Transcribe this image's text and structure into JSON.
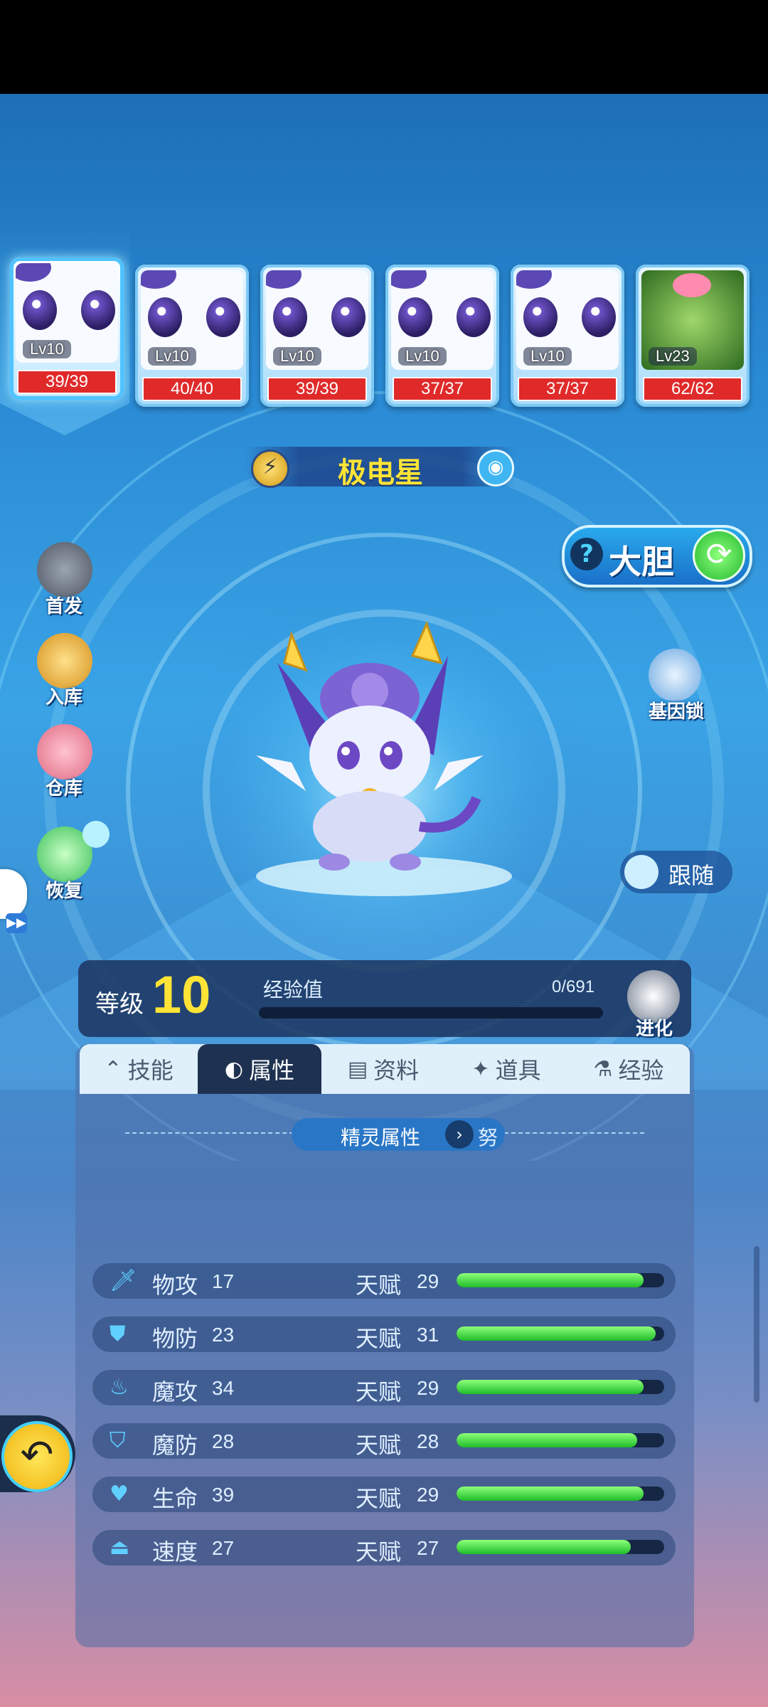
{
  "team": [
    {
      "level": "Lv10",
      "hp": "39/39",
      "selected": true
    },
    {
      "level": "Lv10",
      "hp": "40/40",
      "selected": false
    },
    {
      "level": "Lv10",
      "hp": "39/39",
      "selected": false
    },
    {
      "level": "Lv10",
      "hp": "37/37",
      "selected": false
    },
    {
      "level": "Lv10",
      "hp": "37/37",
      "selected": false
    },
    {
      "level": "Lv23",
      "hp": "62/62",
      "selected": false
    }
  ],
  "pet": {
    "name": "极电星",
    "nature": "大胆"
  },
  "side_left": [
    "首发",
    "入库",
    "仓库",
    "恢复"
  ],
  "side_right": {
    "gene_lock": "基因锁",
    "follow": "跟随"
  },
  "level": {
    "label": "等级",
    "value": "10",
    "exp_label": "经验值",
    "exp_value": "0/691",
    "exp_fraction": 0,
    "evolve": "进化"
  },
  "tabs": [
    {
      "label": "技能",
      "icon": "skill-icon",
      "active": false
    },
    {
      "label": "属性",
      "icon": "attribute-icon",
      "active": true
    },
    {
      "label": "资料",
      "icon": "clipboard-icon",
      "active": false
    },
    {
      "label": "道具",
      "icon": "item-icon",
      "active": false
    },
    {
      "label": "经验",
      "icon": "flask-icon",
      "active": false
    }
  ],
  "attr_header": {
    "title": "精灵属性",
    "extra": "努"
  },
  "talent_label": "天赋",
  "stats": [
    {
      "name": "物攻",
      "value": "17",
      "talent": "29",
      "fill": 0.9,
      "icon": "sword-icon"
    },
    {
      "name": "物防",
      "value": "23",
      "talent": "31",
      "fill": 0.96,
      "icon": "shield-icon"
    },
    {
      "name": "魔攻",
      "value": "34",
      "talent": "29",
      "fill": 0.9,
      "icon": "flame-icon"
    },
    {
      "name": "魔防",
      "value": "28",
      "talent": "28",
      "fill": 0.87,
      "icon": "magic-shield-icon"
    },
    {
      "name": "生命",
      "value": "39",
      "talent": "29",
      "fill": 0.9,
      "icon": "heart-icon"
    },
    {
      "name": "速度",
      "value": "27",
      "talent": "27",
      "fill": 0.84,
      "icon": "boot-icon"
    }
  ],
  "colors": {
    "accent": "#ffe436",
    "hp_red": "#e02a2a",
    "bar_green": "#1fbd2a",
    "panel": "#5b6fa0"
  }
}
